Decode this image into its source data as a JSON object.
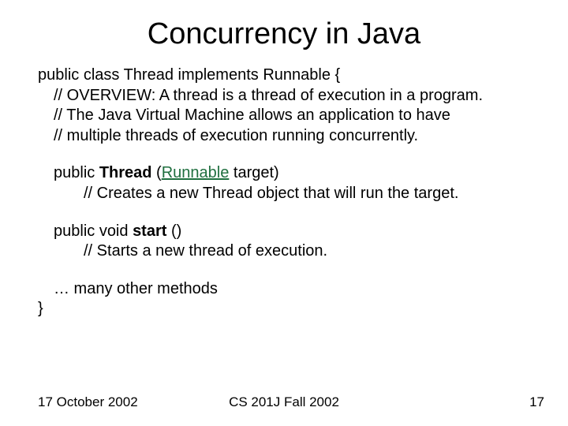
{
  "title": "Concurrency in Java",
  "block1": {
    "l1a": "public class Thread implements Runnable {",
    "l2": "// OVERVIEW: A thread is a thread of execution in a program.",
    "l3": "//    The Java Virtual Machine allows an application to have",
    "l4": "//    multiple threads of execution running concurrently."
  },
  "block2": {
    "sig_pre": "public ",
    "sig_bold": "Thread",
    "sig_mid": " (",
    "sig_link": "Runnable",
    "sig_post": " target)",
    "comment": "// Creates a new Thread object that will run the target."
  },
  "block3": {
    "sig_pre": "public void ",
    "sig_bold": "start",
    "sig_post": " ()",
    "comment": "// Starts a new thread of execution."
  },
  "block4": {
    "more": "… many other methods",
    "end": "}"
  },
  "footer": {
    "date": "17 October 2002",
    "course": "CS 201J Fall 2002",
    "page": "17"
  }
}
